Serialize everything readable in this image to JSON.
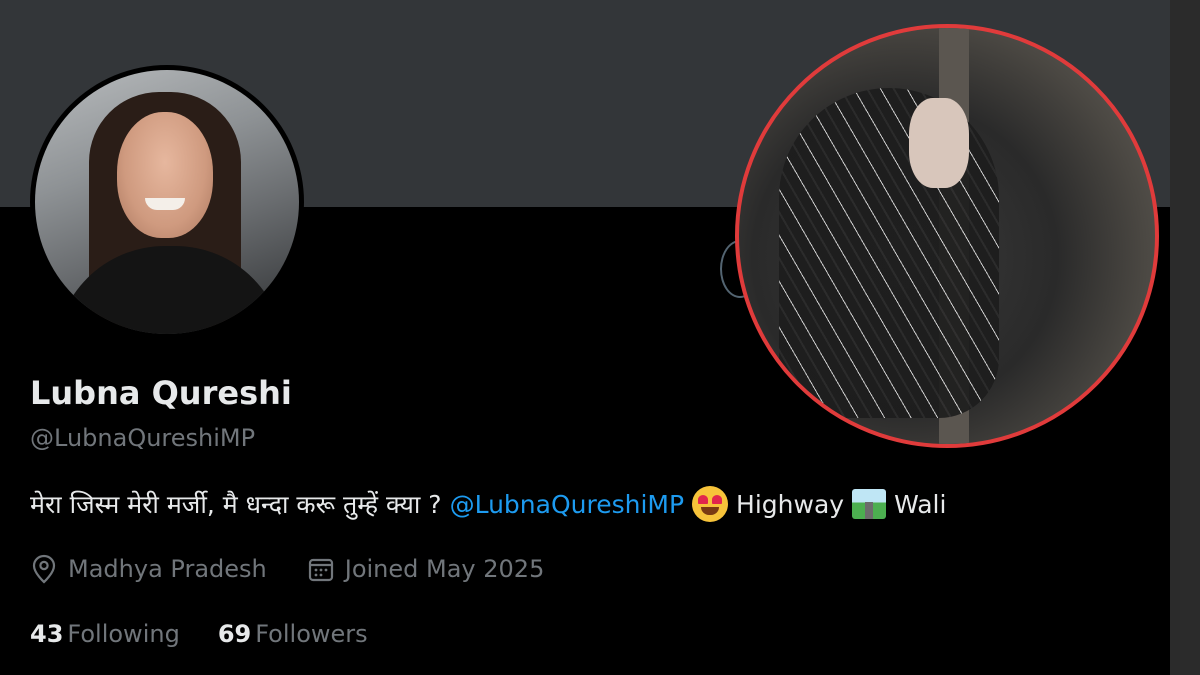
{
  "profile": {
    "name": "Lubna Qureshi",
    "handle": "@LubnaQureshiMP",
    "bio": {
      "text": "मेरा जिस्म मेरी मर्जी, मै धन्दा करू तुम्हें क्या ?",
      "mention": "@LubnaQureshiMP",
      "word1": "Highway",
      "word2": "Wali",
      "emoji1_icon": "heart-eyes-emoji-icon",
      "emoji2_icon": "motorway-emoji-icon"
    },
    "location": "Madhya Pradesh",
    "joined": "Joined May 2025",
    "following_count": "43",
    "following_label": "Following",
    "followers_count": "69",
    "followers_label": "Followers"
  },
  "colors": {
    "background": "#000000",
    "banner": "#333639",
    "accent": "#1d9bf0",
    "muted_text": "#71767b",
    "highlight_circle": "#e03b3b"
  }
}
